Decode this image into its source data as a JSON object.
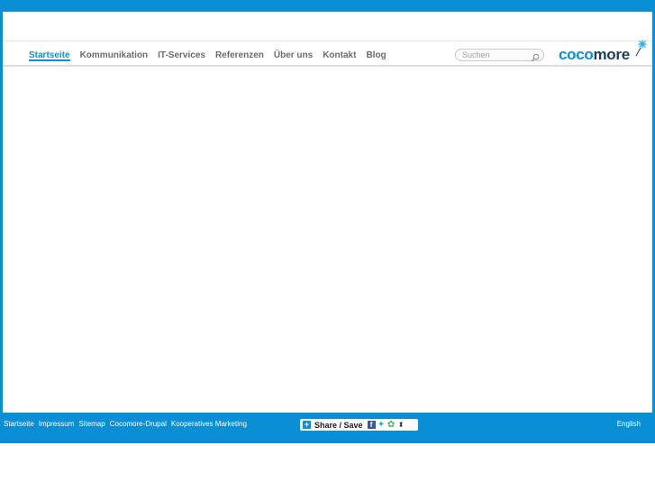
{
  "nav": {
    "items": [
      {
        "label": "Startseite",
        "active": true
      },
      {
        "label": "Kommunikation",
        "active": false
      },
      {
        "label": "IT-Services",
        "active": false
      },
      {
        "label": "Referenzen",
        "active": false
      },
      {
        "label": "Über uns",
        "active": false
      },
      {
        "label": "Kontakt",
        "active": false
      },
      {
        "label": "Blog",
        "active": false
      }
    ]
  },
  "search": {
    "placeholder": "Suchen"
  },
  "logo": {
    "part1": "coco",
    "part2": "more"
  },
  "footer": {
    "links": [
      "Startseite",
      "Impressum",
      "Sitemap",
      "Cocomore-Drupal",
      "Kooperatives Marketing"
    ],
    "share_label": "Share / Save",
    "language": "English"
  },
  "colors": {
    "accent": "#0a8fd4",
    "logo_dark": "#1b3f5c",
    "nav_text": "#6b6b6b"
  }
}
